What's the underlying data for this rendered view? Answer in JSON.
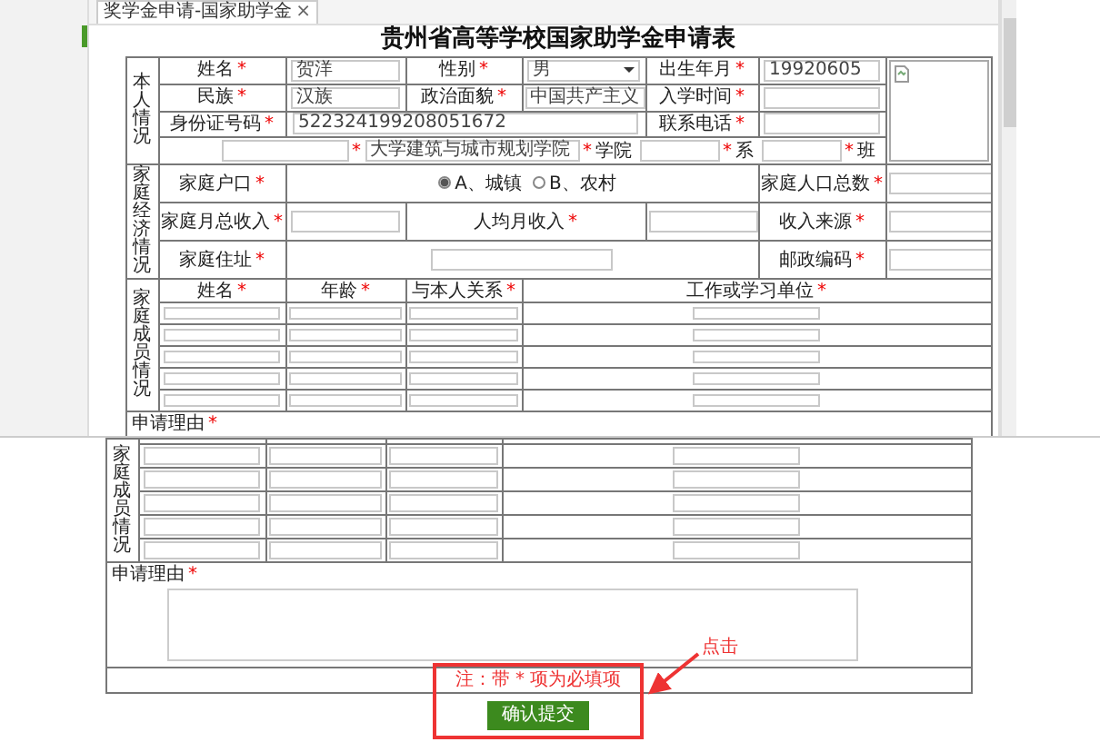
{
  "tab": {
    "label": "奖学金申请-国家助学金",
    "close": "×"
  },
  "title": "贵州省高等学校国家助学金申请表",
  "personal": {
    "section": "本人情况",
    "name": {
      "label": "姓名",
      "mark": "*",
      "value": "贺洋"
    },
    "gender": {
      "label": "性别",
      "mark": "*",
      "value": "男"
    },
    "birth": {
      "label": "出生年月",
      "mark": "*",
      "value": "19920605"
    },
    "ethnicity": {
      "label": "民族",
      "mark": "*",
      "value": "汉族"
    },
    "political": {
      "label": "政治面貌",
      "mark": "*",
      "value": "中国共产主义"
    },
    "enrollment": {
      "label": "入学时间",
      "mark": "*"
    },
    "id_number": {
      "label": "身份证号码",
      "mark": "*",
      "value": "522324199208051672"
    },
    "phone": {
      "label": "联系电话",
      "mark": "*"
    },
    "school_line": [
      {
        "kind": "input"
      },
      {
        "kind": "mark",
        "text": "*"
      },
      {
        "kind": "input",
        "value": "大学建筑与城市规划学院"
      },
      {
        "kind": "mark",
        "text": "*"
      },
      {
        "kind": "text",
        "text": "学院"
      },
      {
        "kind": "input"
      },
      {
        "kind": "mark",
        "text": "*"
      },
      {
        "kind": "text",
        "text": "系"
      },
      {
        "kind": "input"
      },
      {
        "kind": "mark",
        "text": "*"
      },
      {
        "kind": "text",
        "text": "班"
      }
    ]
  },
  "economy": {
    "section": "家庭经济情况",
    "household": {
      "label": "家庭户口",
      "mark": "*",
      "options": [
        {
          "label": "A、城镇",
          "selected": true
        },
        {
          "label": "B、农村",
          "selected": false
        }
      ]
    },
    "size": {
      "label": "家庭人口总数",
      "mark": "*"
    },
    "monthly_income": {
      "label": "家庭月总收入",
      "mark": "*"
    },
    "per_capita": {
      "label": "人均月收入",
      "mark": "*"
    },
    "income_source": {
      "label": "收入来源",
      "mark": "*"
    },
    "address": {
      "label": "家庭住址",
      "mark": "*"
    },
    "postcode": {
      "label": "邮政编码",
      "mark": "*"
    }
  },
  "family": {
    "section": "家庭成员情况",
    "columns": [
      {
        "label": "姓名",
        "mark": "*"
      },
      {
        "label": "年龄",
        "mark": "*"
      },
      {
        "label": "与本人关系",
        "mark": "*"
      },
      {
        "label": "工作或学习单位",
        "mark": "*"
      }
    ]
  },
  "reason": {
    "label": "申请理由",
    "mark": "*"
  },
  "lower_view": {
    "family_section": "家庭成员情况",
    "reason": {
      "label": "申请理由",
      "mark": "*"
    },
    "note": "注：带 * 项为必填项",
    "submit": "确认提交",
    "annotation": "点击"
  }
}
